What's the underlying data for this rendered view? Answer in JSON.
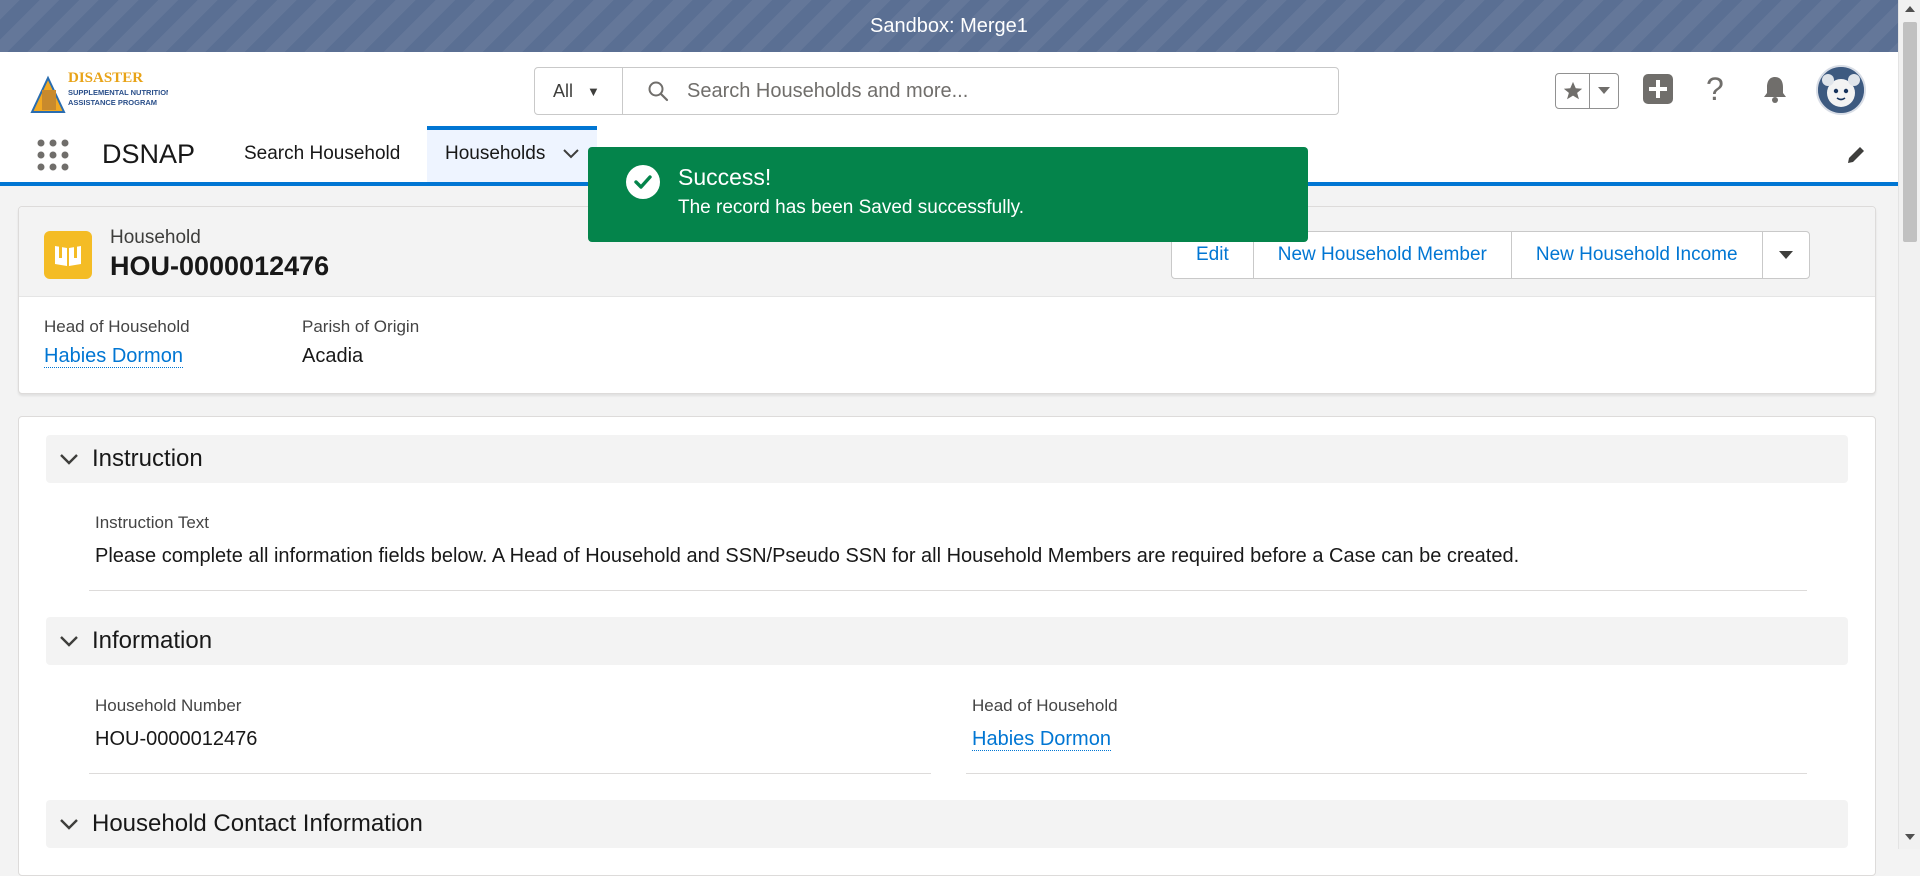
{
  "sandbox": {
    "title": "Sandbox: Merge1"
  },
  "logo": {
    "line1": "DISASTER",
    "line2": "SUPPLEMENTAL NUTRITION",
    "line3": "ASSISTANCE PROGRAM"
  },
  "search": {
    "scope": "All",
    "placeholder": "Search Households and more..."
  },
  "header_icons": [
    "star-icon",
    "chevron-down-icon",
    "add-icon",
    "help-icon",
    "bell-icon",
    "avatar"
  ],
  "app_nav": {
    "app_name": "DSNAP",
    "items": [
      {
        "label": "Search Household"
      },
      {
        "label": "Households"
      }
    ]
  },
  "toast": {
    "title": "Success!",
    "message": "The record has been Saved successfully."
  },
  "record": {
    "type": "Household",
    "title": "HOU-0000012476",
    "actions": {
      "edit": "Edit",
      "new_member": "New Household Member",
      "new_income": "New Household Income"
    },
    "highlights": [
      {
        "label": "Head of Household",
        "value": "Habies Dormon"
      },
      {
        "label": "Parish of Origin",
        "value": "Acadia"
      }
    ]
  },
  "sections": {
    "instruction": {
      "title": "Instruction",
      "field_label": "Instruction Text",
      "field_value": "Please complete all information fields below. A Head of Household and SSN/Pseudo SSN for all Household Members are required before a Case can be created."
    },
    "information": {
      "title": "Information",
      "household_number_label": "Household Number",
      "household_number_value": "HOU-0000012476",
      "head_label": "Head of Household",
      "head_value": "Habies Dormon"
    },
    "contact": {
      "title": "Household Contact Information"
    }
  },
  "colors": {
    "brand": "#0176d3",
    "success": "#04844b",
    "record_icon": "#f4bc25",
    "sandbox": "#5a6f93"
  }
}
